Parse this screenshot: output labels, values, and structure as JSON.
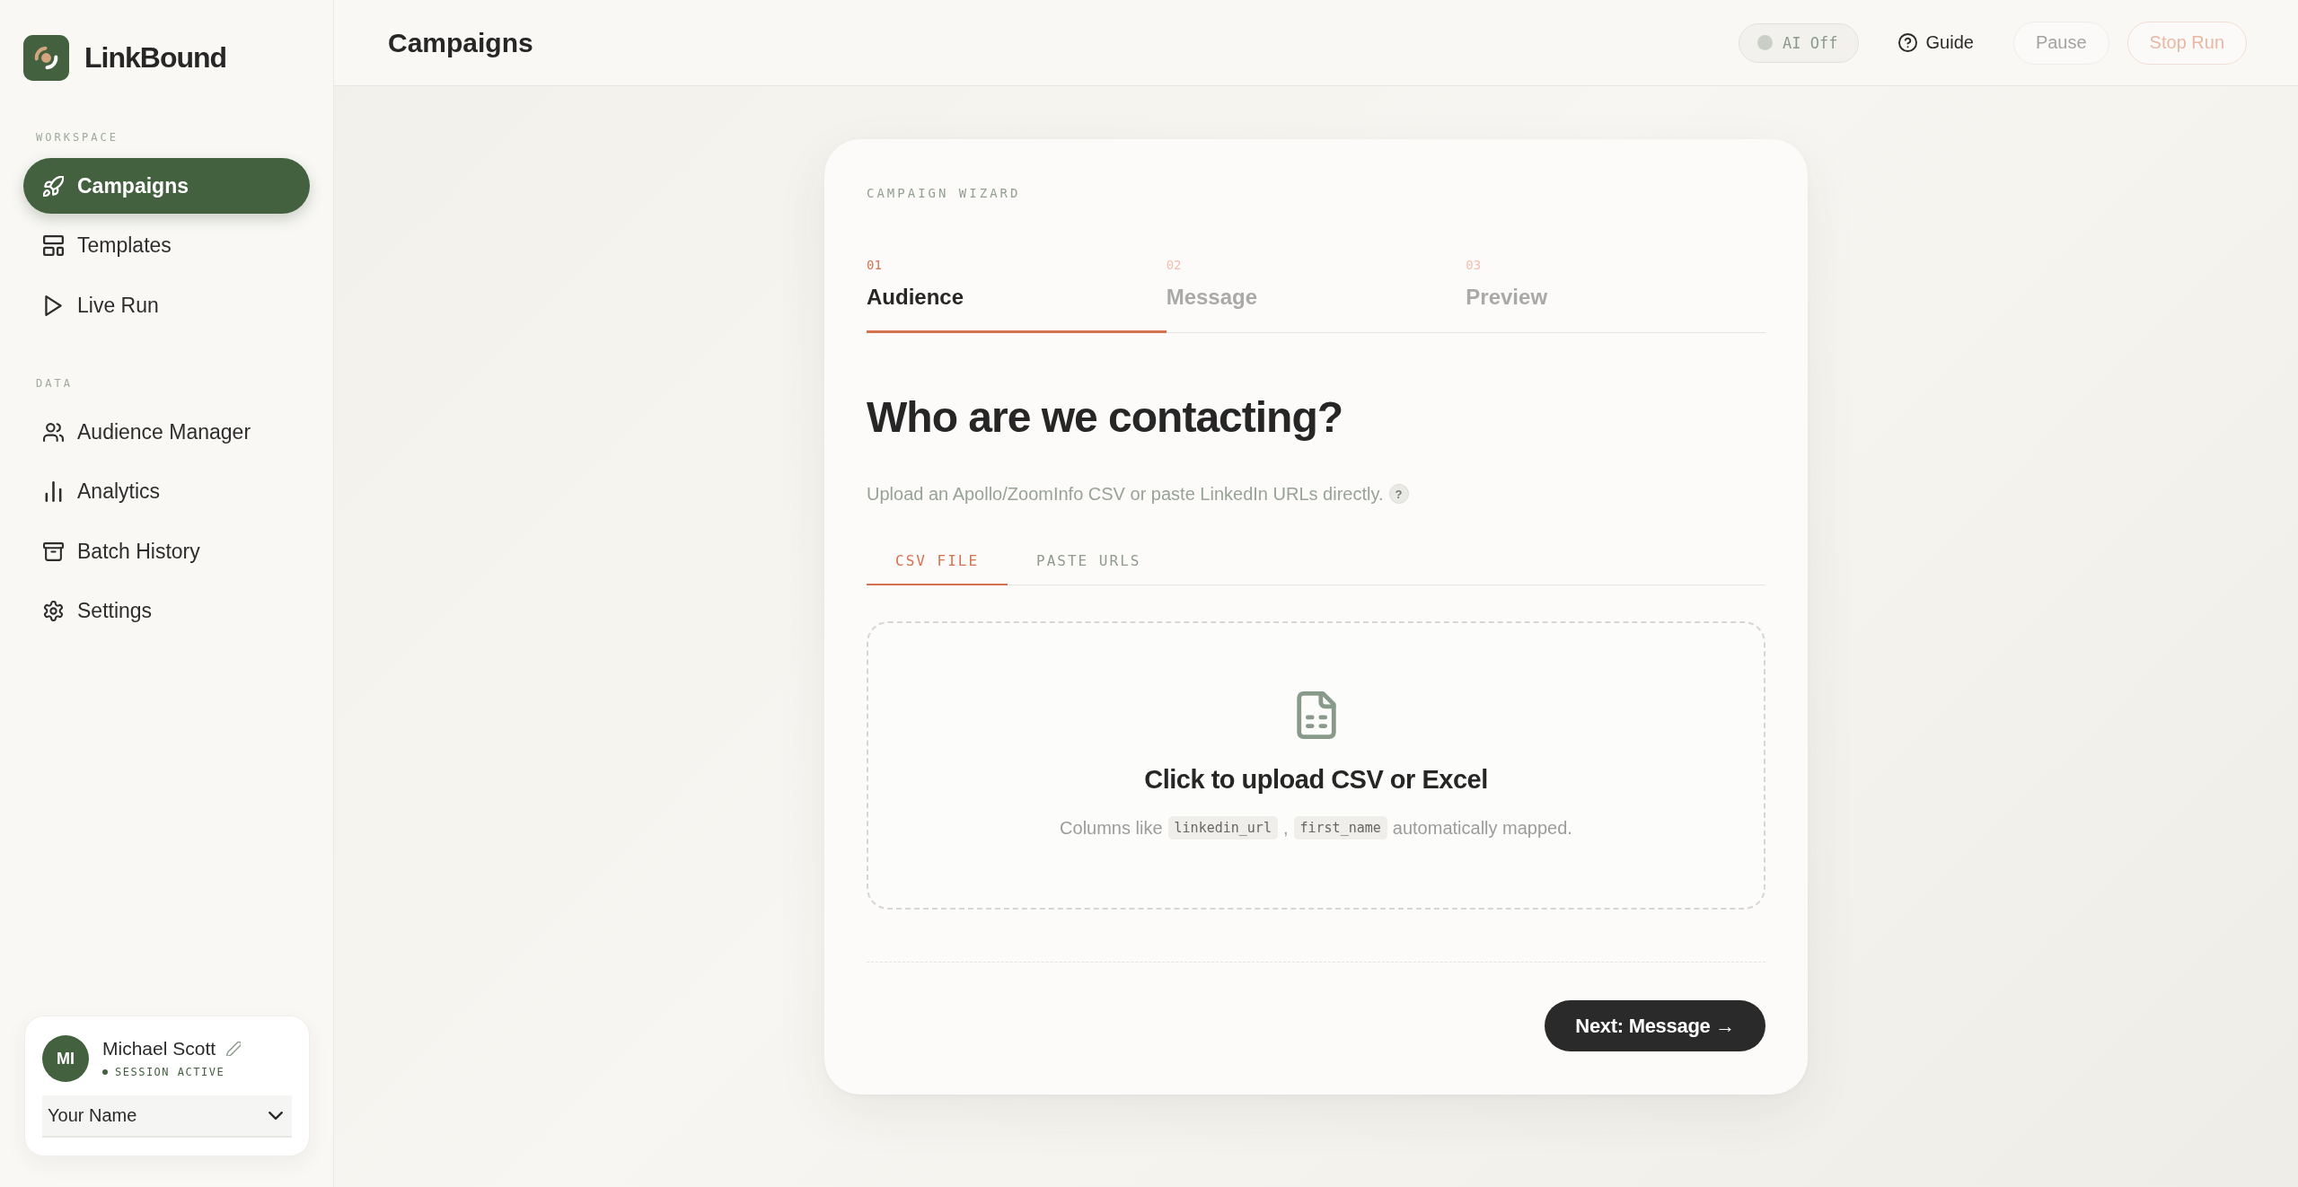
{
  "sidebar": {
    "brand": "LinkBound",
    "sections": [
      {
        "label": "WORKSPACE",
        "items": [
          {
            "label": "Campaigns",
            "selected": true
          },
          {
            "label": "Templates",
            "selected": false
          },
          {
            "label": "Live Run",
            "selected": false
          }
        ]
      },
      {
        "label": "DATA",
        "items": [
          {
            "label": "Audience Manager",
            "selected": false
          },
          {
            "label": "Analytics",
            "selected": false
          },
          {
            "label": "Batch History",
            "selected": false
          },
          {
            "label": "Settings",
            "selected": false
          }
        ]
      }
    ],
    "user": {
      "initials": "MI",
      "name": "Michael Scott",
      "status": "SESSION ACTIVE",
      "select": {
        "value": "Your Name"
      }
    }
  },
  "topbar": {
    "title": "Campaigns",
    "ai_toggle": {
      "label": "AI Off",
      "on": false
    },
    "guide": {
      "label": "Guide"
    },
    "buttons": [
      {
        "label": "Pause",
        "kind": "neutral",
        "disabled": true
      },
      {
        "label": "Stop Run",
        "kind": "danger",
        "disabled": true
      }
    ]
  },
  "wizard": {
    "eyebrow": "CAMPAIGN WIZARD",
    "steps": [
      {
        "number": "01",
        "label": "Audience",
        "selected": true
      },
      {
        "number": "02",
        "label": "Message",
        "selected": false
      },
      {
        "number": "03",
        "label": "Preview",
        "selected": false
      }
    ],
    "heading": "Who are we contacting?",
    "subtitle": "Upload an Apollo/ZoomInfo CSV or paste LinkedIn URLs directly.",
    "help": "?",
    "tabs": [
      {
        "label": "CSV FILE",
        "selected": true
      },
      {
        "label": "PASTE URLS",
        "selected": false
      }
    ],
    "dropzone": {
      "title": "Click to upload CSV or Excel",
      "hint": [
        {
          "kind": "text",
          "text": "Columns like"
        },
        {
          "kind": "code",
          "text": "linkedin_url"
        },
        {
          "kind": "text",
          "text": ","
        },
        {
          "kind": "code",
          "text": "first_name"
        },
        {
          "kind": "text",
          "text": "automatically mapped."
        }
      ]
    },
    "next_button": {
      "label": "Next: Message →"
    }
  }
}
